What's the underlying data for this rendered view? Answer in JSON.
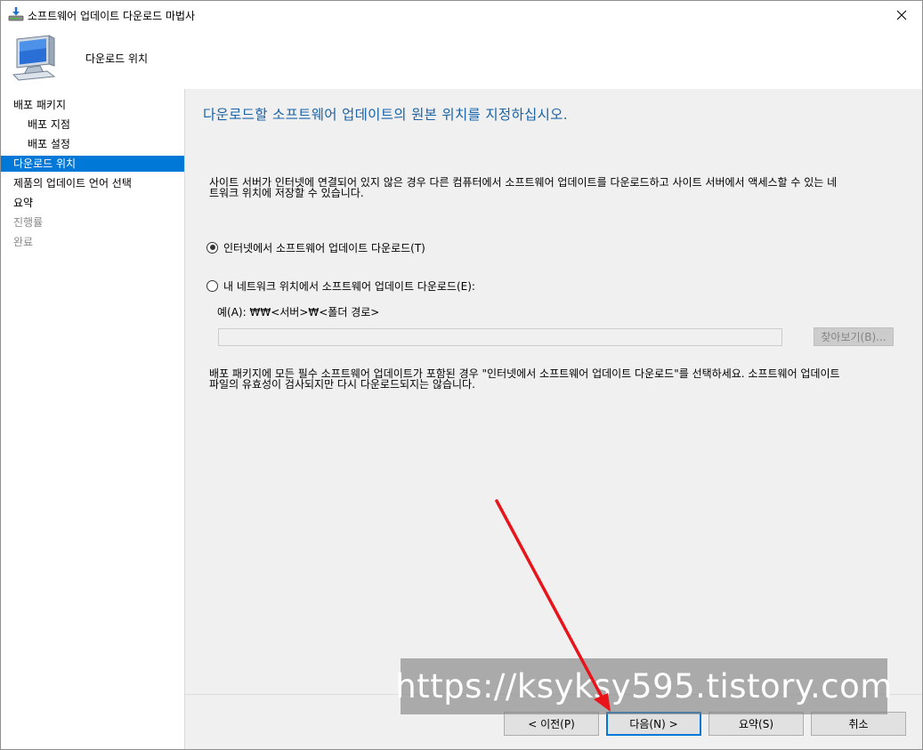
{
  "window": {
    "title": "소프트웨어 업데이트 다운로드 마법사",
    "icon": "download-wizard-icon",
    "close_glyph": "✕"
  },
  "header": {
    "title": "다운로드 위치",
    "icon": "computer-monitor-icon"
  },
  "sidebar": {
    "items": [
      {
        "label": "배포 패키지",
        "state": "normal"
      },
      {
        "label": "배포 지점",
        "state": "normal"
      },
      {
        "label": "배포 설정",
        "state": "normal"
      },
      {
        "label": "다운로드 위치",
        "state": "active"
      },
      {
        "label": "제품의 업데이트 언어 선택",
        "state": "normal"
      },
      {
        "label": "요약",
        "state": "normal"
      },
      {
        "label": "진행률",
        "state": "disabled"
      },
      {
        "label": "완료",
        "state": "disabled"
      }
    ]
  },
  "main": {
    "heading": "다운로드할 소프트웨어 업데이트의 원본 위치를 지정하십시오.",
    "description_line1": "사이트 서버가 인터넷에 연결되어 있지 않은 경우 다른 컴퓨터에서 소프트웨어 업데이트를 다운로드하고 사이트 서버에서 액세스할 수 있는 네",
    "description_line2": "트워크 위치에 저장할 수 있습니다.",
    "option_internet": "인터넷에서 소프트웨어 업데이트 다운로드(T)",
    "option_network": "내 네트워크 위치에서 소프트웨어 업데이트 다운로드(E):",
    "selected_option": "internet",
    "example": "예(A): ₩₩<서버>₩<폴더 경로>",
    "path_value": "",
    "browse_label": "찾아보기(B)...",
    "note_line1": "배포 패키지에 모든 필수 소프트웨어 업데이트가 포함된 경우 \"인터넷에서 소프트웨어 업데이트 다운로드\"를 선택하세요. 소프트웨어 업데이트",
    "note_line2": "파일의 유효성이 검사되지만 다시 다운로드되지는 않습니다."
  },
  "buttons": {
    "prev": "< 이전(P)",
    "next": "다음(N) >",
    "summary": "요약(S)",
    "cancel": "취소"
  },
  "watermark": {
    "text": "https://ksyksy595.tistory.com"
  },
  "colors": {
    "accent": "#0078d7",
    "heading": "#1a63a8",
    "annotation": "#e8141a"
  }
}
